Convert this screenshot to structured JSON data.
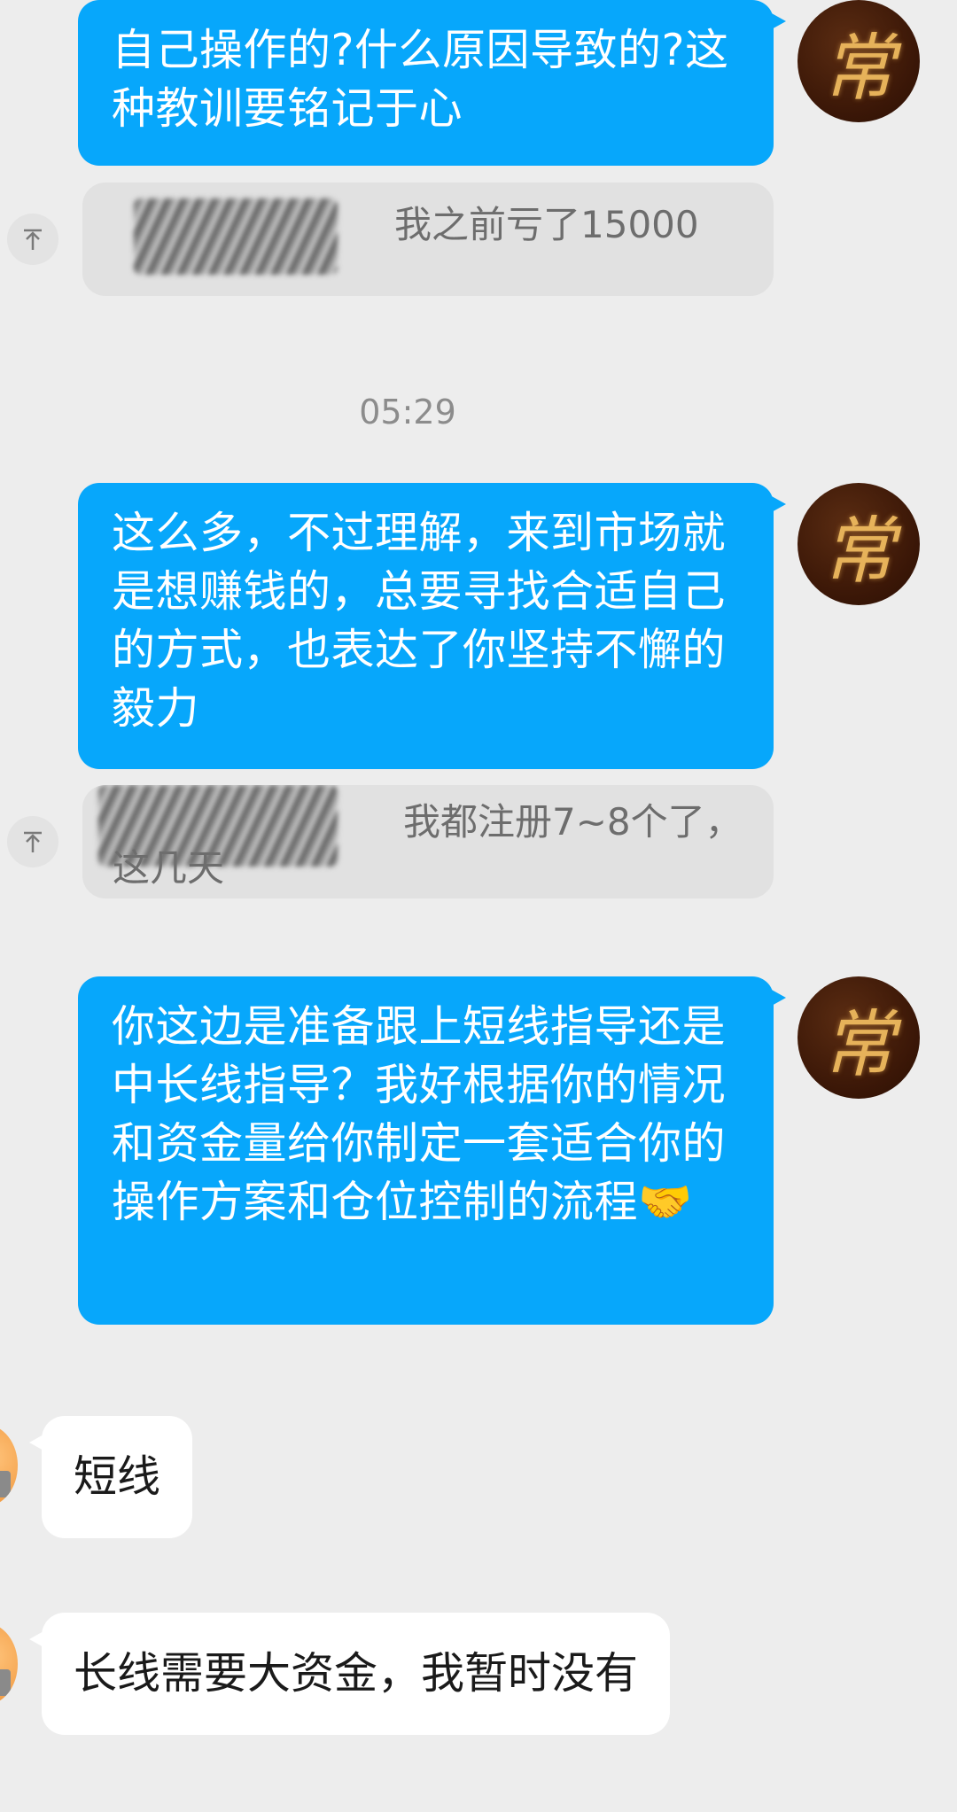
{
  "messages": {
    "m1": {
      "text": "自己操作的?什么原因导致的?这种教训要铭记于心"
    },
    "q1": {
      "text": "我之前亏了15000"
    },
    "timestamp": "05:29",
    "m2": {
      "text": "这么多，不过理解，来到市场就是想赚钱的，总要寻找合适自己的方式，也表达了你坚持不懈的毅力"
    },
    "q2": {
      "line1": "我都注册7~8个了，",
      "line2": "这几天"
    },
    "m3": {
      "text": "你这边是准备跟上短线指导还是中长线指导？我好根据你的情况和资金量给你制定一套适合你的操作方案和仓位控制的流程🤝"
    },
    "r1": {
      "text": "短线"
    },
    "r2": {
      "text": "长线需要大资金，我暂时没有"
    }
  },
  "avatar_self": {
    "glyph": "常",
    "bg_color": "#3b1707",
    "glyph_color": "#e6b25a"
  },
  "icons": {
    "quote_jump": "arrow-up-to-top-icon"
  },
  "colors": {
    "outgoing_bubble": "#07a7fb",
    "incoming_bubble": "#ffffff",
    "background": "#ededed",
    "quote_bg": "#e1e1e1"
  }
}
